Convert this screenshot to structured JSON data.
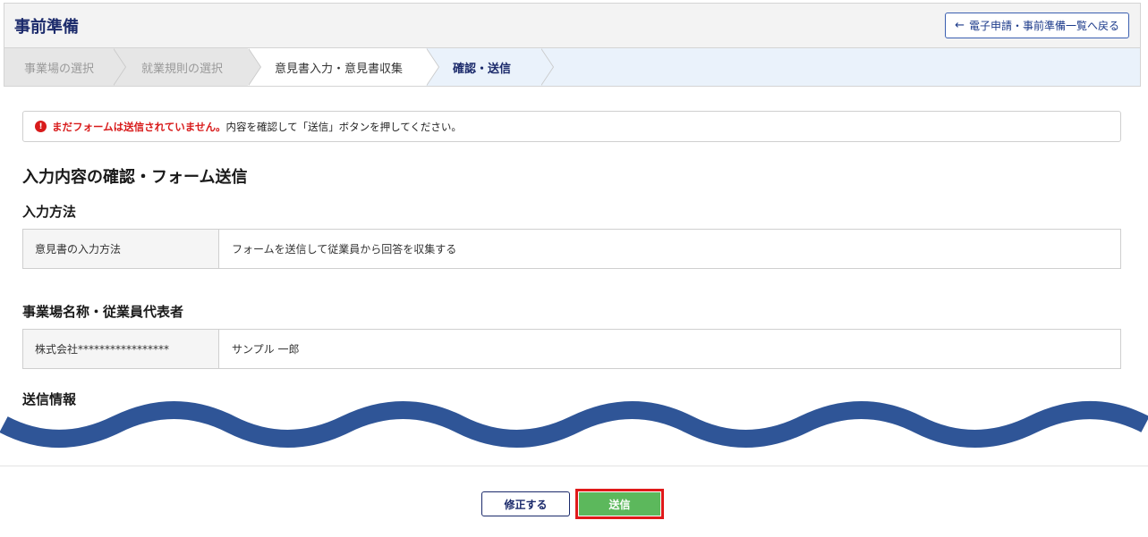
{
  "header": {
    "title": "事前準備",
    "back_button": "電子申請・事前準備一覧へ戻る"
  },
  "steps": [
    {
      "label": "事業場の選択",
      "state": "done"
    },
    {
      "label": "就業規則の選択",
      "state": "done"
    },
    {
      "label": "意見書入力・意見書収集",
      "state": "normal"
    },
    {
      "label": "確認・送信",
      "state": "current"
    }
  ],
  "alert": {
    "icon": "!",
    "strong": "まだフォームは送信されていません。",
    "text": "内容を確認して「送信」ボタンを押してください。"
  },
  "page_title": "入力内容の確認・フォーム送信",
  "sections": {
    "input_method": {
      "title": "入力方法",
      "label": "意見書の入力方法",
      "value": "フォームを送信して従業員から回答を収集する"
    },
    "workplace": {
      "title": "事業場名称・従業員代表者",
      "label": "株式会社*****************",
      "value": "サンプル 一郎"
    },
    "send_info": {
      "title": "送信情報"
    }
  },
  "buttons": {
    "edit": "修正する",
    "send": "送信"
  },
  "colors": {
    "accent": "#1b2a6b",
    "alert": "#d81b1b",
    "send": "#5cb85c",
    "wave": "#2f5597"
  }
}
